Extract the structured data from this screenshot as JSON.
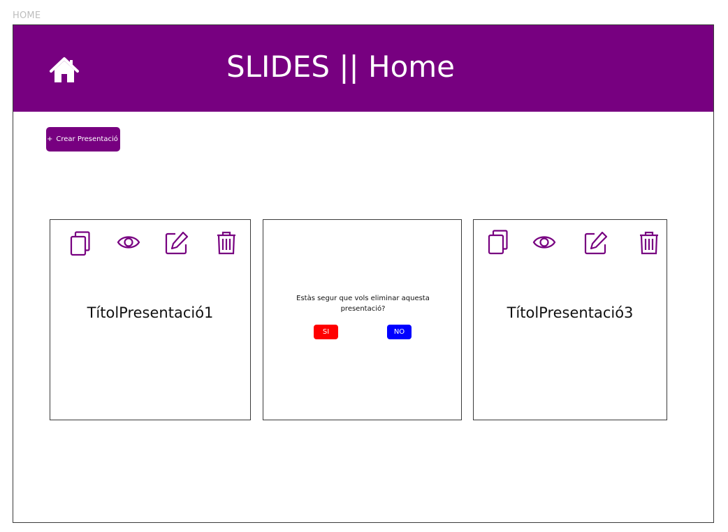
{
  "frame": {
    "label": "HOME"
  },
  "header": {
    "title": "SLIDES || Home",
    "home_icon": "home-icon",
    "background": "#770080"
  },
  "toolbar": {
    "create_icon": "+",
    "create_label": "Crear Presentació"
  },
  "cards": [
    {
      "title": "TítolPresentació1",
      "icons": [
        "copy-icon",
        "eye-icon",
        "edit-icon",
        "trash-icon"
      ]
    },
    {
      "confirm_message": "Estàs segur que vols eliminar aquesta presentació?",
      "yes_label": "SI",
      "no_label": "NO",
      "yes_color": "#ff0000",
      "no_color": "#0000ff"
    },
    {
      "title": "TítolPresentació3",
      "icons": [
        "copy-icon",
        "eye-icon",
        "edit-icon",
        "trash-icon"
      ]
    }
  ],
  "colors": {
    "accent": "#770080",
    "icon": "#770080"
  }
}
